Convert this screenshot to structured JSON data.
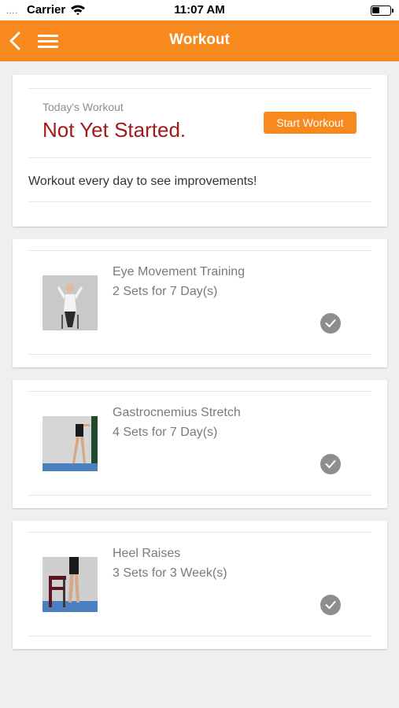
{
  "status_bar": {
    "signal": "....",
    "carrier": "Carrier",
    "time": "11:07 AM"
  },
  "nav": {
    "title": "Workout"
  },
  "summary": {
    "label": "Today's Workout",
    "status": "Not Yet Started.",
    "start_button": "Start Workout",
    "message": "Workout every day to see improvements!"
  },
  "exercises": [
    {
      "name": "Eye Movement Training",
      "sets": "2 Sets for 7 Day(s)",
      "thumbnail": "person-standing-arms-raised-image"
    },
    {
      "name": "Gastrocnemius Stretch",
      "sets": "4 Sets for 7 Day(s)",
      "thumbnail": "calf-stretch-against-wall-image"
    },
    {
      "name": "Heel Raises",
      "sets": "3 Sets for 3 Week(s)",
      "thumbnail": "heel-raise-with-chair-image"
    }
  ],
  "colors": {
    "accent": "#f7891e",
    "status_red": "#a01a1a",
    "check_gray": "#8e8e8e",
    "background": "#efefef"
  },
  "icons": {
    "back": "chevron-left-icon",
    "menu": "hamburger-menu-icon",
    "wifi": "wifi-icon",
    "battery": "battery-icon",
    "complete": "checkmark-circle-icon"
  }
}
